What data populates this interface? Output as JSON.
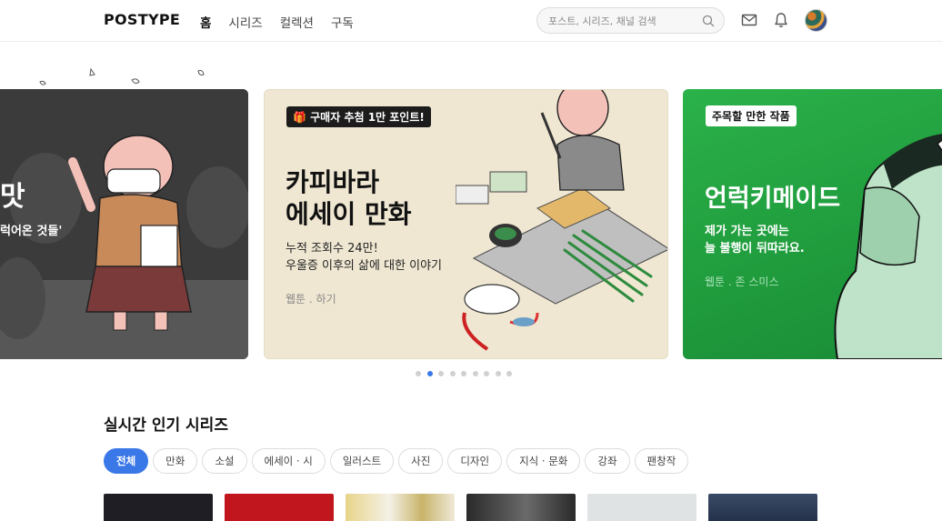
{
  "header": {
    "logo": "POSTYPE",
    "nav": [
      "홈",
      "시리즈",
      "컬렉션",
      "구독"
    ],
    "search_placeholder": "포스트, 시리즈, 채널 검색"
  },
  "carousel": {
    "left": {
      "title": "맛",
      "subtitle": "럭어온 것들'"
    },
    "middle": {
      "badge": "구매자 추첨 1만 포인트!",
      "title_line1": "카피바라",
      "title_line2": "에세이 만화",
      "sub_line1": "누적 조회수 24만!",
      "sub_line2": "우울증 이후의 삶에 대한 이야기",
      "meta": "웹툰 . 하기"
    },
    "right": {
      "badge": "주목할 만한 작품",
      "title": "언럭키메이드",
      "sub_line1": "제가 가는 곳에는",
      "sub_line2": "늘 불행이 뒤따라요.",
      "meta": "웹툰 . 존 스미스"
    },
    "dots_total": 9,
    "dots_active": 1
  },
  "section": {
    "title": "실시간 인기 시리즈",
    "categories": [
      "전체",
      "만화",
      "소설",
      "에세이 · 시",
      "일러스트",
      "사진",
      "디자인",
      "지식 · 문화",
      "강좌",
      "팬창작"
    ]
  },
  "colors": {
    "accent": "#3a78e8",
    "green_slide": "#22a543",
    "beige_slide": "#efe7d2"
  }
}
